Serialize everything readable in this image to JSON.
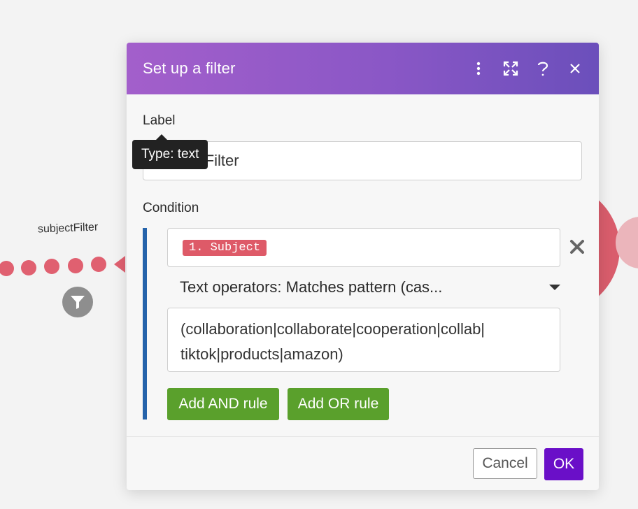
{
  "canvas": {
    "route_label": "subjectFilter"
  },
  "dialog": {
    "title": "Set up a filter",
    "header_icons": [
      "more-vertical-icon",
      "expand-icon",
      "help-icon",
      "close-icon"
    ],
    "label_section": {
      "label": "Label",
      "value": "subjectFilter",
      "tooltip": "Type: text"
    },
    "condition_section": {
      "label": "Condition",
      "field_pill": "1. Subject",
      "operator": "Text operators: Matches pattern (cas...",
      "pattern_line1": "(collaboration|collaborate|cooperation|collab|",
      "pattern_line2": "tiktok|products|amazon)",
      "add_and_label": "Add AND rule",
      "add_or_label": "Add OR rule"
    },
    "footer": {
      "cancel_label": "Cancel",
      "ok_label": "OK"
    }
  },
  "colors": {
    "header_start": "#a35fcb",
    "header_end": "#6b4fbb",
    "route": "#e06070",
    "condition_bar": "#2563ab",
    "green_button": "#5aa02c",
    "ok_button": "#6a0fc8",
    "pill": "#de5a68"
  }
}
